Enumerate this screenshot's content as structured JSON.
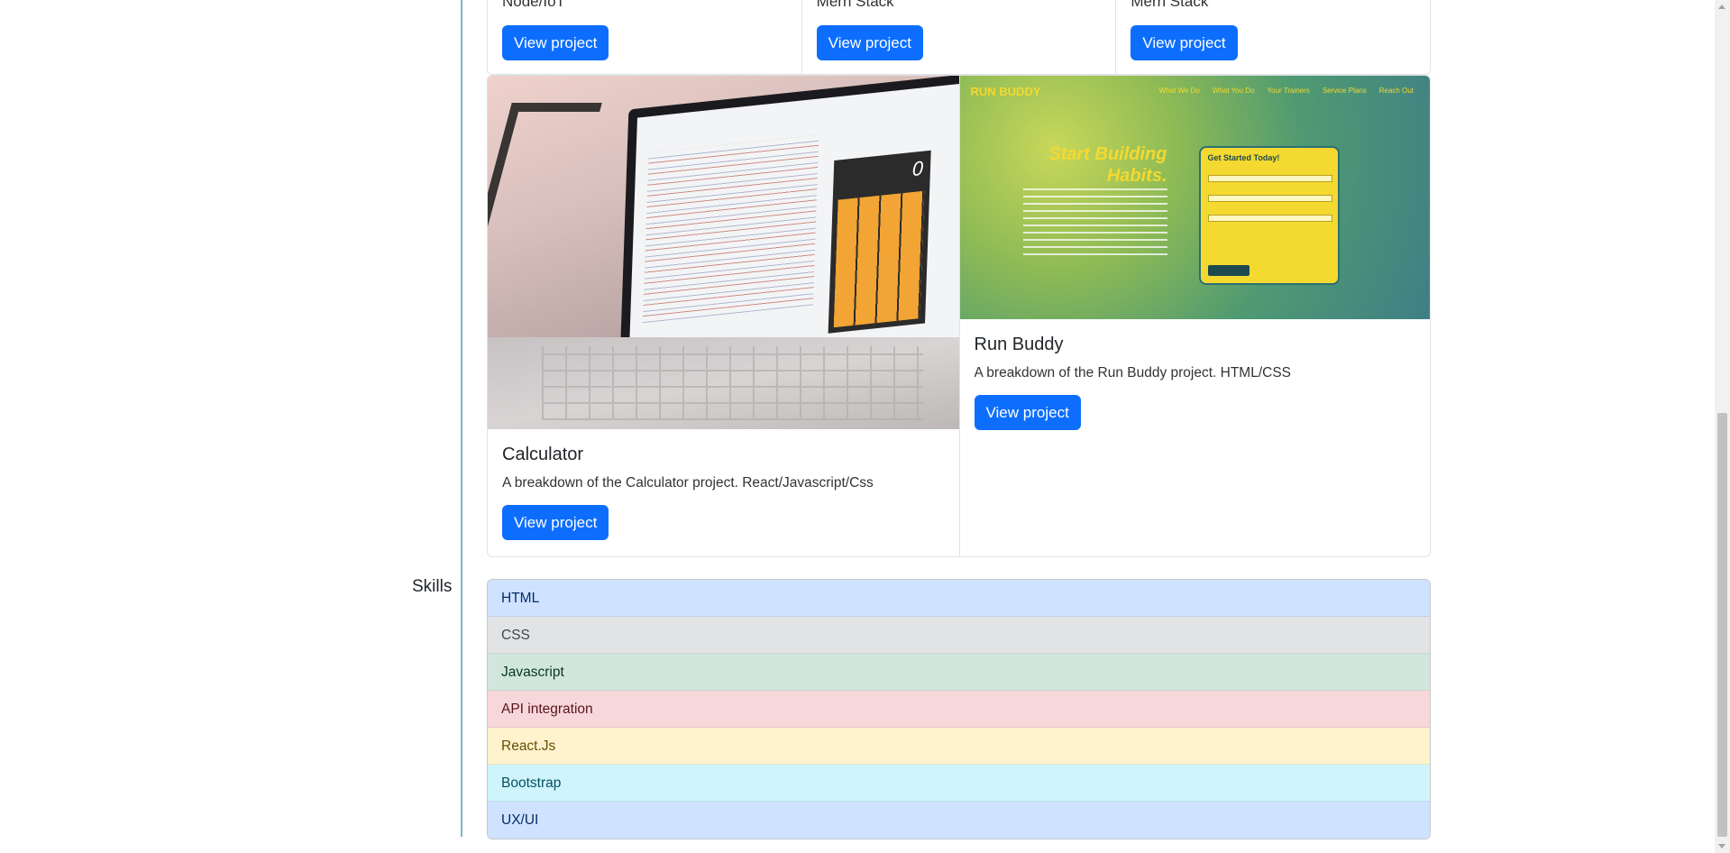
{
  "top_row": [
    {
      "subtitle": "Node/IoT",
      "button": "View project"
    },
    {
      "subtitle": "Mern Stack",
      "button": "View project"
    },
    {
      "subtitle": "Mern Stack",
      "button": "View project"
    }
  ],
  "projects": [
    {
      "title": "Calculator",
      "description": "A breakdown of the Calculator project. React/Javascript/Css",
      "button": "View project",
      "image": {
        "screen_value": "0"
      }
    },
    {
      "title": "Run Buddy",
      "description": "A breakdown of the Run Buddy project. HTML/CSS",
      "button": "View project",
      "image": {
        "brand": "RUN BUDDY",
        "nav": [
          "What We Do",
          "What You Do",
          "Your Trainers",
          "Service Plans",
          "Reach Out"
        ],
        "headline": "Start Building Habits.",
        "form_title": "Get Started Today!"
      }
    }
  ],
  "skills": {
    "label": "Skills",
    "items": [
      {
        "label": "HTML",
        "variant": "primary"
      },
      {
        "label": "CSS",
        "variant": "secondary"
      },
      {
        "label": "Javascript",
        "variant": "success"
      },
      {
        "label": "API integration",
        "variant": "danger"
      },
      {
        "label": "React.Js",
        "variant": "warning"
      },
      {
        "label": "Bootstrap",
        "variant": "info"
      },
      {
        "label": "UX/UI",
        "variant": "primary"
      }
    ]
  },
  "colors": {
    "button": "#0d6efd",
    "section_rule": "#7fb7c2",
    "run_buddy_yellow": "#f4d930"
  }
}
